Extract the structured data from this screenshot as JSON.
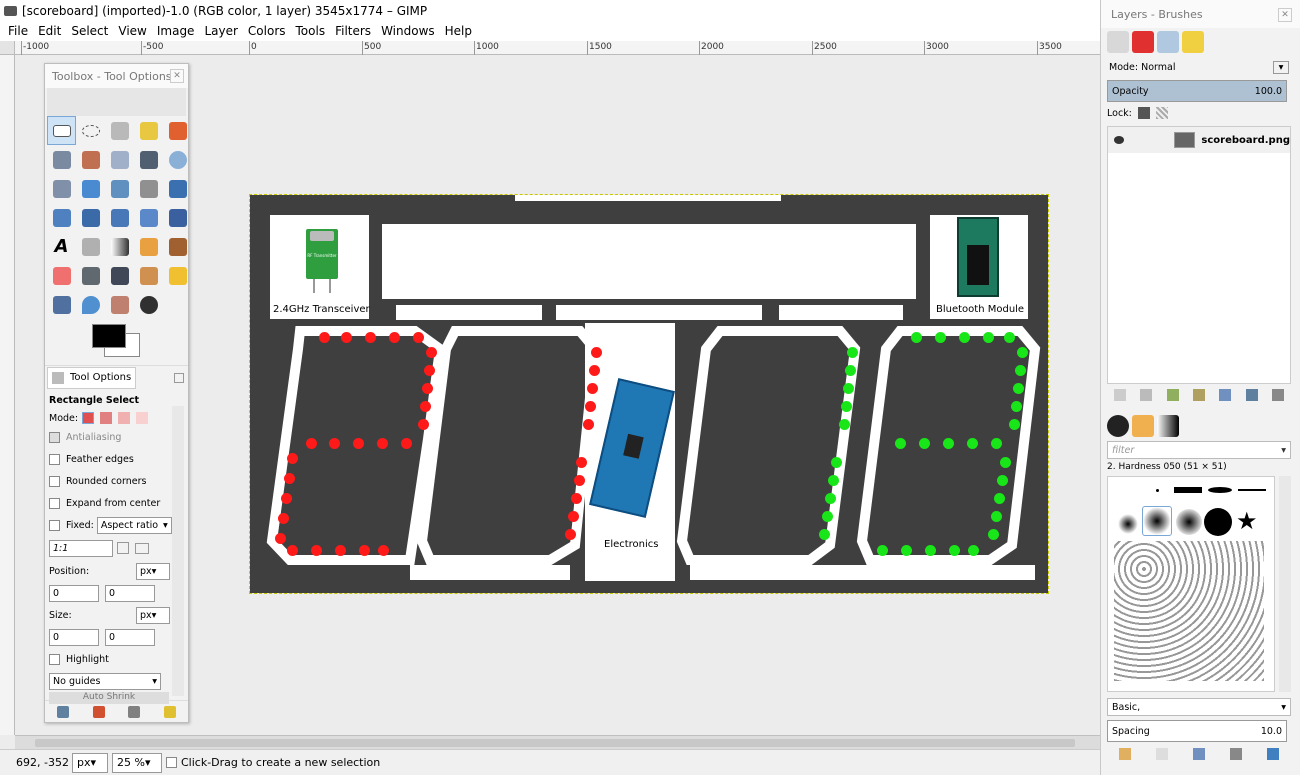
{
  "window": {
    "title": "[scoreboard] (imported)-1.0 (RGB color, 1 layer) 3545x1774 – GIMP"
  },
  "menu": [
    "File",
    "Edit",
    "Select",
    "View",
    "Image",
    "Layer",
    "Colors",
    "Tools",
    "Filters",
    "Windows",
    "Help"
  ],
  "ruler": {
    "h_labels": [
      "-1000",
      "-500",
      "0",
      "500",
      "1000",
      "1500",
      "2000",
      "2500",
      "3000",
      "3500"
    ]
  },
  "image": {
    "label_transceiver": "2.4GHz Transceiver",
    "label_bluetooth": "Bluetooth Module",
    "label_electronics": "Electronics",
    "rf_chip_text": "RF Transmitter"
  },
  "toolbox": {
    "title": "Toolbox - Tool Options",
    "tab_label": "Tool Options",
    "tool_name": "Rectangle Select",
    "mode_label": "Mode:",
    "antialiasing": "Antialiasing",
    "feather": "Feather edges",
    "rounded": "Rounded corners",
    "expand": "Expand from center",
    "fixed": "Fixed:",
    "fixed_value": "Aspect ratio",
    "ratio": "1:1",
    "position_label": "Position:",
    "size_label": "Size:",
    "unit": "px",
    "pos_x": "0",
    "pos_y": "0",
    "size_x": "0",
    "size_y": "0",
    "highlight": "Highlight",
    "guides": "No guides",
    "auto_shrink": "Auto Shrink"
  },
  "status": {
    "coords": "692, -352",
    "unit": "px",
    "zoom": "25 %",
    "message": "Click-Drag to create a new selection"
  },
  "dock": {
    "title": "Layers - Brushes",
    "mode_label": "Mode: Normal",
    "opacity_label": "Opacity",
    "opacity_value": "100.0",
    "lock_label": "Lock:",
    "layer_name": "scoreboard.png",
    "filter_placeholder": "filter",
    "brush_name": "2. Hardness 050 (51 × 51)",
    "preset": "Basic,",
    "spacing_label": "Spacing",
    "spacing_value": "10.0"
  },
  "colors": {
    "board": "#3f3f3f",
    "led_red": "#ff1a1a",
    "led_green": "#19e619",
    "arduino": "#1f78b4",
    "opacity_bar": "#aec1d3"
  }
}
